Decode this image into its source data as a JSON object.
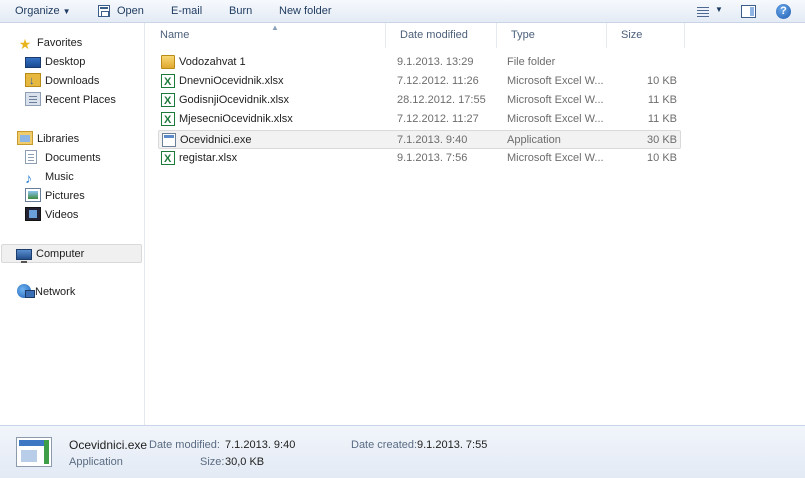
{
  "toolbar": {
    "organize_label": "Organize",
    "open_label": "Open",
    "email_label": "E-mail",
    "burn_label": "Burn",
    "new_folder_label": "New folder"
  },
  "nav": {
    "favorites": "Favorites",
    "desktop": "Desktop",
    "downloads": "Downloads",
    "recent_places": "Recent Places",
    "libraries": "Libraries",
    "documents": "Documents",
    "music": "Music",
    "pictures": "Pictures",
    "videos": "Videos",
    "computer": "Computer",
    "network": "Network"
  },
  "columns": {
    "name": "Name",
    "date_modified": "Date modified",
    "type": "Type",
    "size": "Size"
  },
  "files": [
    {
      "name": "Vodozahvat 1",
      "date": "9.1.2013. 13:29",
      "type": "File folder",
      "size": "",
      "icon": "folder-icon"
    },
    {
      "name": "DnevniOcevidnik.xlsx",
      "date": "7.12.2012. 11:26",
      "type": "Microsoft Excel W...",
      "size": "10 KB",
      "icon": "excel-file-icon"
    },
    {
      "name": "GodisnjiOcevidnik.xlsx",
      "date": "28.12.2012. 17:55",
      "type": "Microsoft Excel W...",
      "size": "11 KB",
      "icon": "excel-file-icon"
    },
    {
      "name": "MjesecniOcevidnik.xlsx",
      "date": "7.12.2012. 11:27",
      "type": "Microsoft Excel W...",
      "size": "11 KB",
      "icon": "excel-file-icon"
    },
    {
      "name": "Ocevidnici.exe",
      "date": "7.1.2013. 9:40",
      "type": "Application",
      "size": "30 KB",
      "icon": "application-icon"
    },
    {
      "name": "registar.xlsx",
      "date": "9.1.2013. 7:56",
      "type": "Microsoft Excel W...",
      "size": "10 KB",
      "icon": "excel-file-icon"
    }
  ],
  "details": {
    "file_name": "Ocevidnici.exe",
    "file_type": "Application",
    "date_modified_label": "Date modified:",
    "date_modified_value": "7.1.2013. 9:40",
    "size_label": "Size:",
    "size_value": "30,0 KB",
    "date_created_label": "Date created:",
    "date_created_value": "9.1.2013. 7:55"
  }
}
